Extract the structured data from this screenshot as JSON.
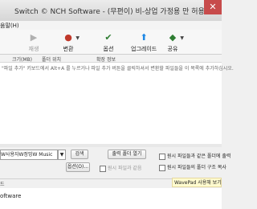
{
  "window": {
    "title": "Switch © NCH Software - (무편이) 비-상업 가정용 만 허용",
    "close": "✕"
  },
  "menu": {
    "help": "움말(H)"
  },
  "toolbar": {
    "play_label": "재생",
    "convert_label": "변환",
    "options_label": "옵션",
    "upgrade_label": "업그레이드",
    "share_label": "공유"
  },
  "list": {
    "columns": [
      "크기(MB)",
      "폴더 위치",
      "확장 정보"
    ],
    "empty_hint": "\"파일 추가\" 키보드에서 Alt+A 를 누르거나 파일 추가 버튼을 클릭하셔서 변환할 파일들을 이 목록에 추가하십시오."
  },
  "bottom": {
    "output_folder": "W사용자W정밍W Music",
    "browse_label": "검색",
    "open_folder_label": "출력 폴더 열기",
    "options_label": "옵션(O)...",
    "same_folder_label": "원시 파일과 같음",
    "check1_label": "원시 파일들과 같은 폴더에 출력",
    "check2_label": "원시 파일들의 폴더 구조 복사"
  },
  "status": {
    "left": "드",
    "notice": "WavePad 사용해 보기"
  },
  "footer": {
    "text": "oftware"
  },
  "colors": {
    "close": "#c74b4b",
    "notice_bg": "#fffbcf"
  }
}
